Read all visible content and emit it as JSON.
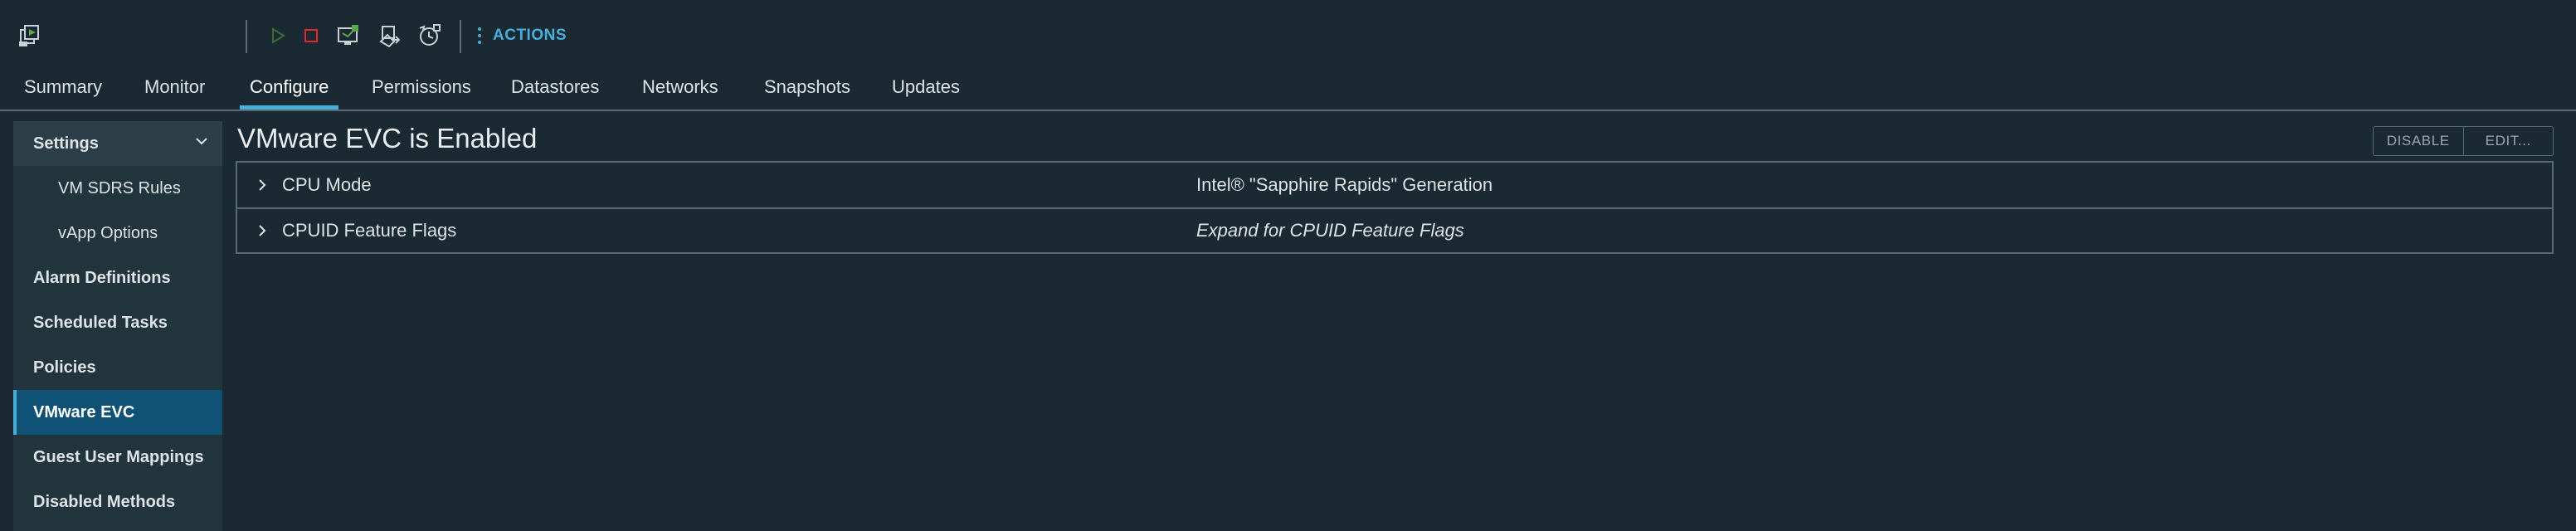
{
  "toolbar": {
    "actions_label": "ACTIONS",
    "icons": [
      "vm-icon",
      "power-on-icon",
      "power-off-icon",
      "launch-console-icon",
      "migrate-icon",
      "snapshot-icon"
    ],
    "colors": {
      "accent": "#49afd9",
      "power_on": "#5aa64b",
      "power_off": "#e02b2b"
    }
  },
  "tabs": [
    {
      "label": "Summary"
    },
    {
      "label": "Monitor"
    },
    {
      "label": "Configure",
      "active": true
    },
    {
      "label": "Permissions"
    },
    {
      "label": "Datastores"
    },
    {
      "label": "Networks"
    },
    {
      "label": "Snapshots"
    },
    {
      "label": "Updates"
    }
  ],
  "sidebar": {
    "header": {
      "label": "Settings",
      "expanded": true
    },
    "items": [
      {
        "label": "VM SDRS Rules"
      },
      {
        "label": "vApp Options"
      },
      {
        "label": "Alarm Definitions"
      },
      {
        "label": "Scheduled Tasks"
      },
      {
        "label": "Policies"
      },
      {
        "label": "VMware EVC",
        "active": true
      },
      {
        "label": "Guest User Mappings"
      },
      {
        "label": "Disabled Methods"
      }
    ]
  },
  "main": {
    "title": "VMware EVC is Enabled",
    "buttons": {
      "disable": "DISABLE",
      "edit": "EDIT..."
    },
    "rows": [
      {
        "label": "CPU Mode",
        "value": "Intel® \"Sapphire Rapids\" Generation"
      },
      {
        "label": "CPUID Feature Flags",
        "value": "Expand for CPUID Feature Flags"
      }
    ]
  }
}
